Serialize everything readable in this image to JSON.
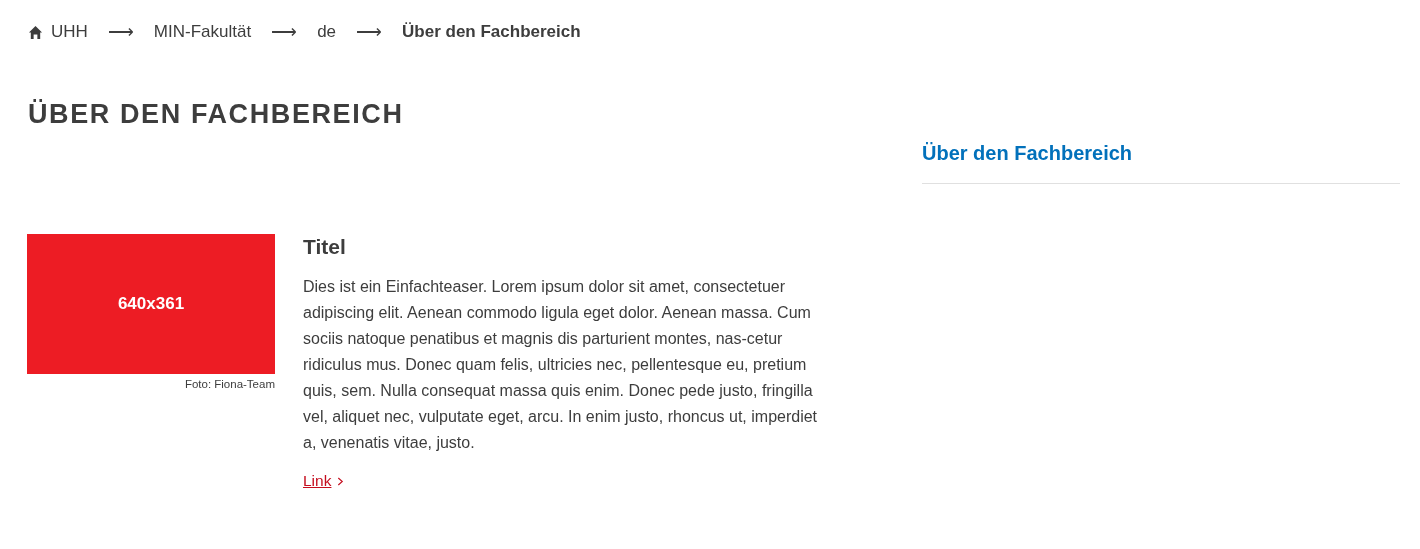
{
  "breadcrumb": [
    {
      "label": "UHH",
      "current": false
    },
    {
      "separator": "⟶",
      "label": "MIN-Fakultät",
      "current": false
    },
    {
      "separator": "⟶",
      "label": "de",
      "current": false
    },
    {
      "separator": "⟶",
      "label": "Über den Fachbereich",
      "current": true
    }
  ],
  "page_title": "ÜBER DEN FACHBEREICH",
  "teaser": {
    "image_placeholder": "640x361",
    "caption": "Foto: Fiona-Team",
    "title": "Titel",
    "text": "Dies ist ein Einfachteaser. Lorem ipsum dolor sit amet, consectetuer adipiscing elit. Aenean commodo ligula eget dolor. Aenean massa. Cum sociis natoque penatibus et magnis dis parturient montes, nas-cetur ridiculus mus. Donec quam felis, ultricies nec, pellentesque eu, pretium quis, sem. Nulla consequat massa quis enim. Donec pede justo, fringilla vel, aliquet nec, vulputate eget, arcu. In enim justo, rhoncus ut, imperdiet a, venenatis vitae, justo.",
    "link": "Link"
  },
  "sidebar": {
    "title": "Über den Fachbereich"
  }
}
